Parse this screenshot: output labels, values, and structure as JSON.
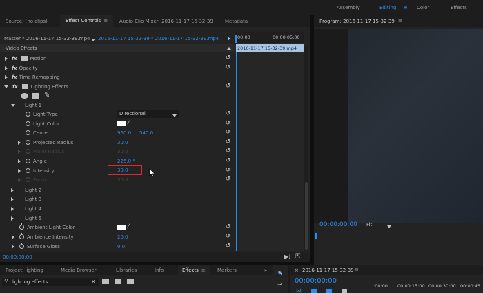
{
  "workspaces": {
    "tabs": [
      {
        "label": "Assembly"
      },
      {
        "label": "Editing",
        "active": true
      },
      {
        "label": "Color"
      },
      {
        "label": "Effects"
      }
    ]
  },
  "left_panel": {
    "tabs": [
      {
        "label": "Source: (no clips)"
      },
      {
        "label": "Effect Controls",
        "active": true
      },
      {
        "label": "Audio Clip Mixer: 2016-11-17 15-32-39"
      },
      {
        "label": "Metadata"
      }
    ],
    "master_label": "Master * 2016-11-17 15-32-39.mp4",
    "sequence_clip_label": "2016-11-17 15-32-39 * 2016-11-17 15-32-39.mp4",
    "section_title": "Video Effects",
    "effects": {
      "motion": "Motion",
      "opacity": "Opacity",
      "time_remapping": "Time Remapping",
      "lighting_effects": "Lighting Effects"
    },
    "light1": {
      "label": "Light 1",
      "light_type": {
        "label": "Light Type",
        "value": "Directional"
      },
      "light_color": {
        "label": "Light Color",
        "color": "#ffffff"
      },
      "center": {
        "label": "Center",
        "x": "960.0",
        "y": "540.0"
      },
      "projected_radius": {
        "label": "Projected Radius",
        "value": "30.0"
      },
      "major_radius": {
        "label": "Major Radius",
        "value": "30.0"
      },
      "angle": {
        "label": "Angle",
        "value": "225.0 °"
      },
      "intensity": {
        "label": "Intensity",
        "value": "30.0"
      },
      "focus": {
        "label": "Focus",
        "value": "50.0"
      }
    },
    "lights": [
      "Light 2",
      "Light 3",
      "Light 4",
      "Light 5"
    ],
    "ambient_light_color": {
      "label": "Ambient Light Color",
      "color": "#ffffff"
    },
    "ambience_intensity": {
      "label": "Ambience Intensity",
      "value": "20.0"
    },
    "surface_gloss": {
      "label": "Surface Gloss",
      "value": "0.0"
    },
    "timecode": "00:00:00:00"
  },
  "mini_timeline": {
    "ruler_start": "00:00",
    "ruler_end": "00:00:05:00",
    "clip_label": "2016-11-17 15-32-39.mp4"
  },
  "program_monitor": {
    "title": "Program: 2016-11-17 15-32-39",
    "timecode": "00:00:00:00",
    "fit": "Fit"
  },
  "bottom_left": {
    "tabs": [
      {
        "label": "Project: lighting"
      },
      {
        "label": "Media Browser"
      },
      {
        "label": "Libraries"
      },
      {
        "label": "Info"
      },
      {
        "label": "Effects",
        "active": true
      },
      {
        "label": "Markers"
      }
    ],
    "overflow": "»",
    "search_value": "lighting effects"
  },
  "timeline": {
    "title": "2016-11-17 15-32-39",
    "timecode": "00:00:00:00",
    "ruler": [
      ":00:00",
      "00:00:15:00",
      "00:00:30:00",
      "00:00:45"
    ]
  },
  "colors": {
    "accent_blue": "#2d8ceb",
    "highlight_red": "#e0282e",
    "panel_bg": "#232323"
  }
}
